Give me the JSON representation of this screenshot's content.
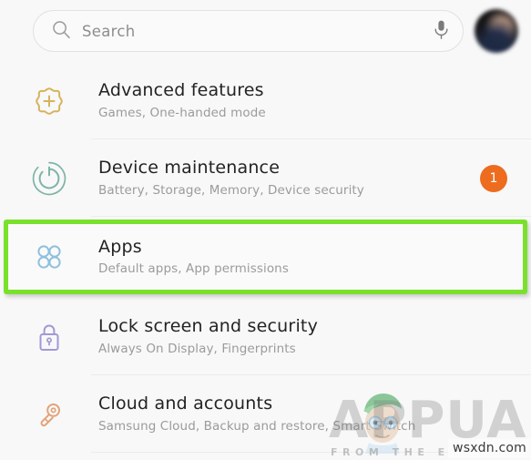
{
  "header": {
    "search": {
      "icon": "search-icon",
      "placeholder": "Search",
      "value": "",
      "mic_icon": "microphone-icon"
    },
    "avatar": {
      "icon": "avatar",
      "label": ""
    }
  },
  "list": {
    "items": [
      {
        "icon": "advanced-features-icon",
        "icon_color": "#d6b35c",
        "title": "Advanced features",
        "subtitle": "Games, One-handed mode",
        "badge": "",
        "highlighted": false
      },
      {
        "icon": "device-maintenance-icon",
        "icon_color": "#7fb4a5",
        "title": "Device maintenance",
        "subtitle": "Battery, Storage, Memory, Device security",
        "badge": "1",
        "highlighted": false
      },
      {
        "icon": "apps-icon",
        "icon_color": "#8fc0dd",
        "title": "Apps",
        "subtitle": "Default apps, App permissions",
        "badge": "",
        "highlighted": true
      },
      {
        "icon": "lock-screen-icon",
        "icon_color": "#a299d6",
        "title": "Lock screen and security",
        "subtitle": "Always On Display, Fingerprints",
        "badge": "",
        "highlighted": false
      },
      {
        "icon": "cloud-accounts-key-icon",
        "icon_color": "#e3a379",
        "title": "Cloud and accounts",
        "subtitle": "Samsung Cloud, Backup and restore, Smart Switch",
        "badge": "",
        "highlighted": false
      }
    ]
  },
  "watermark": {
    "word": "APPUALS",
    "tagline": "FROM THE EXPERTS",
    "domain": "wsxdn.com",
    "mascot": "mascot-icon"
  },
  "colors": {
    "highlight_green": "#79e12c",
    "badge_orange": "#ed6c1f",
    "background": "#f8f8f8",
    "title_text": "#232323",
    "subtitle_text": "#9b9b9b"
  }
}
